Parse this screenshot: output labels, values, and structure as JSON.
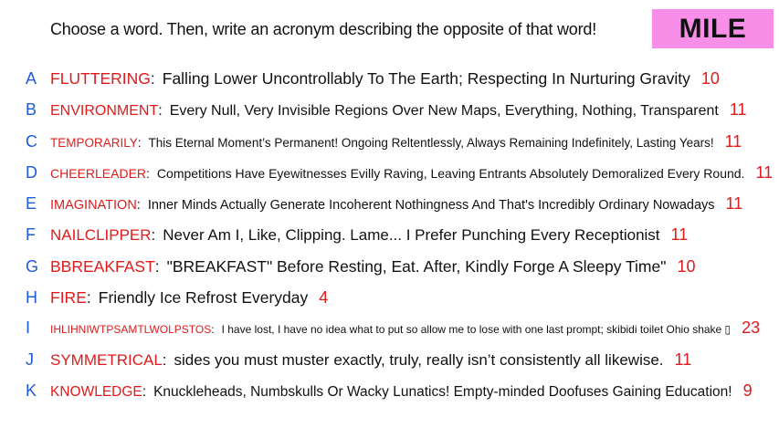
{
  "prompt": "Choose a word. Then, write an acronym describing the opposite of that word!",
  "badge": {
    "text": "MILE",
    "bg": "#f78ee8"
  },
  "colors": {
    "letter": "#1e5bd6",
    "word": "#e01b1b",
    "count": "#e01b1b",
    "text": "#111111"
  },
  "entries": [
    {
      "letter": "A",
      "word": "FLUTTERING",
      "phrase": "Falling Lower Uncontrollably To The Earth; Respecting In Nurturing Gravity",
      "count": "10"
    },
    {
      "letter": "B",
      "word": "ENVIRONMENT",
      "phrase": "Every Null, Very Invisible Regions Over New Maps, Everything, Nothing, Transparent",
      "count": "11"
    },
    {
      "letter": "C",
      "word": "TEMPORARILY",
      "phrase": "This Eternal Moment’s Permanent! Ongoing Reltentlessly, Always Remaining Indefinitely, Lasting Years!",
      "count": "11"
    },
    {
      "letter": "D",
      "word": "CHEERLEADER",
      "phrase": "Competitions Have Eyewitnesses Evilly Raving, Leaving Entrants Absolutely Demoralized Every Round.",
      "count": "11"
    },
    {
      "letter": "E",
      "word": "IMAGINATION",
      "phrase": "Inner Minds Actually Generate Incoherent Nothingness And That's Incredibly Ordinary Nowadays",
      "count": "11"
    },
    {
      "letter": "F",
      "word": "NAILCLIPPER",
      "phrase": "Never Am I, Like, Clipping. Lame... I Prefer Punching Every Receptionist",
      "count": "11"
    },
    {
      "letter": "G",
      "word": "BBREAKFAST",
      "phrase": "\"BREAKFAST\" Before Resting, Eat. After, Kindly Forge A Sleepy Time\"",
      "count": "10"
    },
    {
      "letter": "H",
      "word": "FIRE",
      "phrase": "Friendly Ice Refrost Everyday",
      "count": "4"
    },
    {
      "letter": "I",
      "word": "IHLIHNIWTPSAMTLWOLPSTOS",
      "phrase": "I have lost, I have no idea what to put so allow me to lose with one last prompt; skibidi toilet Ohio shake ▯",
      "count": "23"
    },
    {
      "letter": "J",
      "word": "SYMMETRICAL",
      "phrase": "sides you must muster exactly, truly, really isn’t consistently all likewise.",
      "count": "11"
    },
    {
      "letter": "K",
      "word": "KNOWLEDGE",
      "phrase": "Knuckleheads, Numbskulls Or Wacky Lunatics! Empty-minded Doofuses Gaining Education!",
      "count": "9"
    }
  ]
}
